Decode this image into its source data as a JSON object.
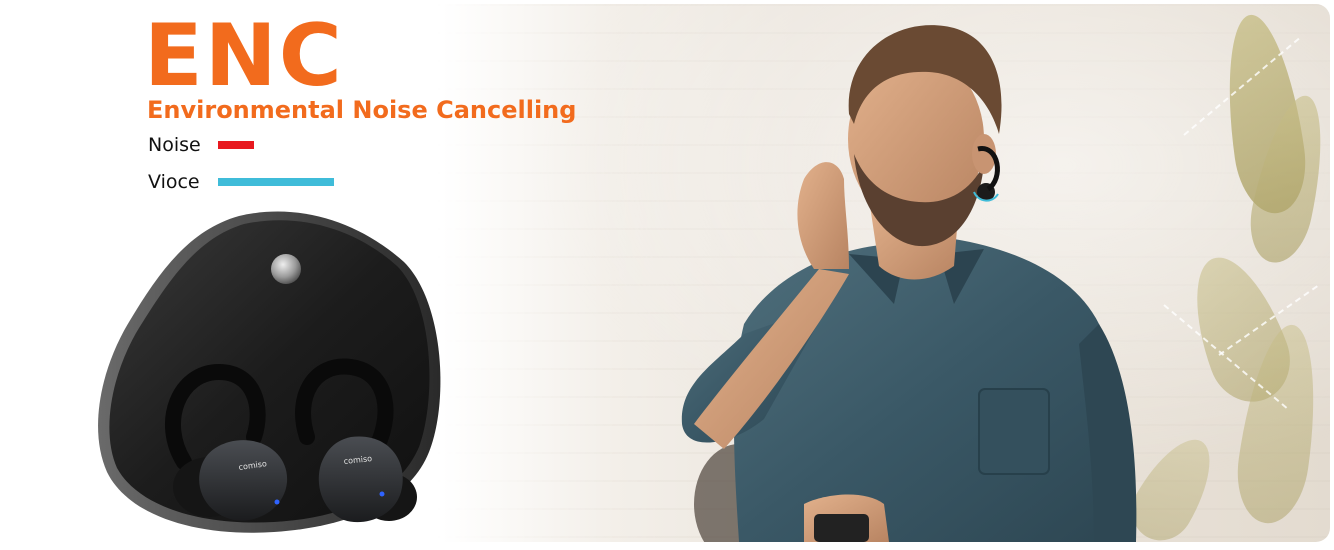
{
  "headline": {
    "title": "ENC",
    "subtitle": "Environmental Noise Cancelling"
  },
  "legend": {
    "items": [
      {
        "label": "Noise",
        "color": "#e8191f"
      },
      {
        "label": "Vioce",
        "color": "#3fbcd9"
      }
    ]
  },
  "product": {
    "brand_left": "comiso",
    "brand_right": "comiso"
  },
  "colors": {
    "accent": "#f26b1d",
    "noise": "#e8191f",
    "voice": "#3fbcd9"
  }
}
